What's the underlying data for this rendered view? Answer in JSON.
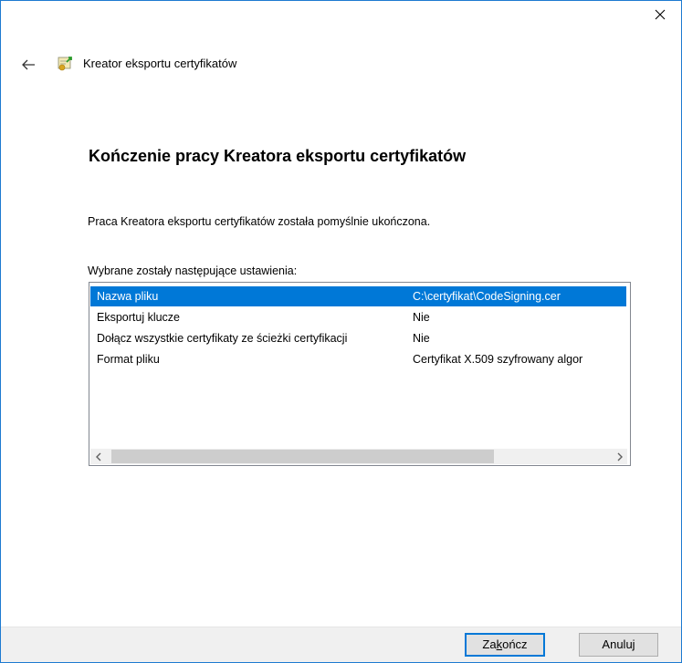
{
  "window": {
    "close_icon": "close-icon",
    "back_icon": "back-arrow-icon",
    "wizard_icon": "certificate-export-icon",
    "wizard_title": "Kreator eksportu certyfikatów"
  },
  "main": {
    "heading": "Kończenie pracy Kreatora eksportu certyfikatów",
    "status_text": "Praca Kreatora eksportu certyfikatów została pomyślnie ukończona.",
    "settings_label": "Wybrane zostały następujące ustawienia:",
    "settings": [
      {
        "name": "Nazwa pliku",
        "value": "C:\\certyfikat\\CodeSigning.cer"
      },
      {
        "name": "Eksportuj klucze",
        "value": "Nie"
      },
      {
        "name": "Dołącz wszystkie certyfikaty ze ścieżki certyfikacji",
        "value": "Nie"
      },
      {
        "name": "Format pliku",
        "value": "Certyfikat X.509 szyfrowany algor"
      }
    ],
    "selected_row": 0,
    "scroll_left_icon": "chevron-left-icon",
    "scroll_right_icon": "chevron-right-icon"
  },
  "footer": {
    "finish_label": "Zakończ",
    "finish_accel_prefix": "Za",
    "finish_accel_letter": "k",
    "finish_accel_suffix": "ończ",
    "cancel_label": "Anuluj"
  },
  "colors": {
    "accent": "#0078d7",
    "window_border": "#1e7ad1",
    "footer_bg": "#f0f0f0"
  }
}
